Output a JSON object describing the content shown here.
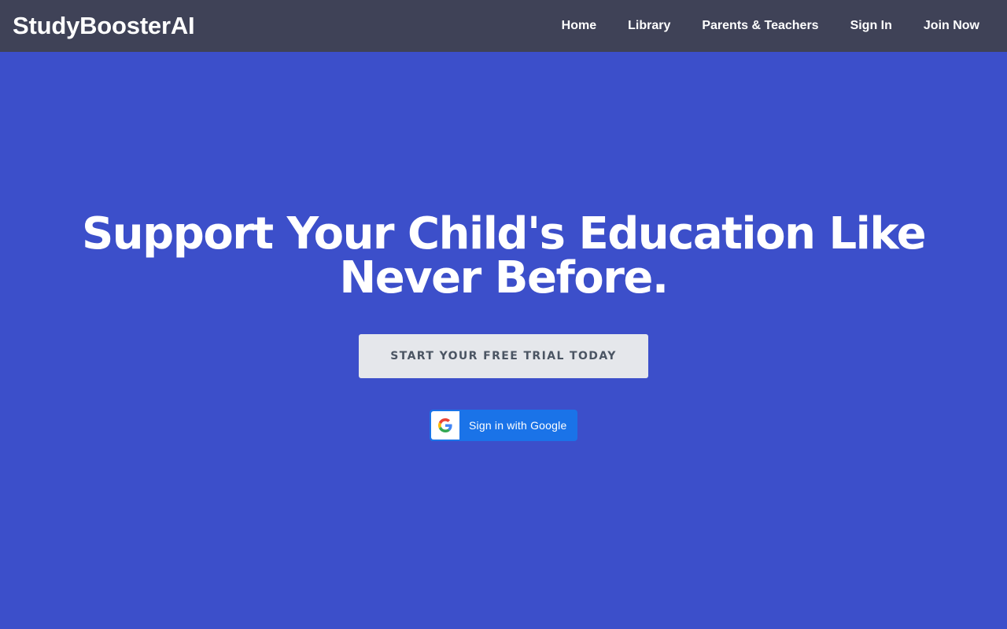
{
  "header": {
    "brand": "StudyBoosterAI",
    "nav": [
      {
        "label": "Home"
      },
      {
        "label": "Library"
      },
      {
        "label": "Parents & Teachers"
      },
      {
        "label": "Sign In"
      },
      {
        "label": "Join Now"
      }
    ]
  },
  "hero": {
    "title_line1": "Support Your Child's Education Like",
    "title_line2": "Never Before.",
    "cta_label": "START YOUR FREE TRIAL TODAY",
    "google_label": "Sign in with Google",
    "google_icon": "google-g-icon"
  },
  "colors": {
    "background": "#3c4fca",
    "navbar": "#3f4257",
    "cta_background": "#e5e7eb",
    "cta_text": "#4b5563",
    "google_button": "#1a73e8"
  }
}
